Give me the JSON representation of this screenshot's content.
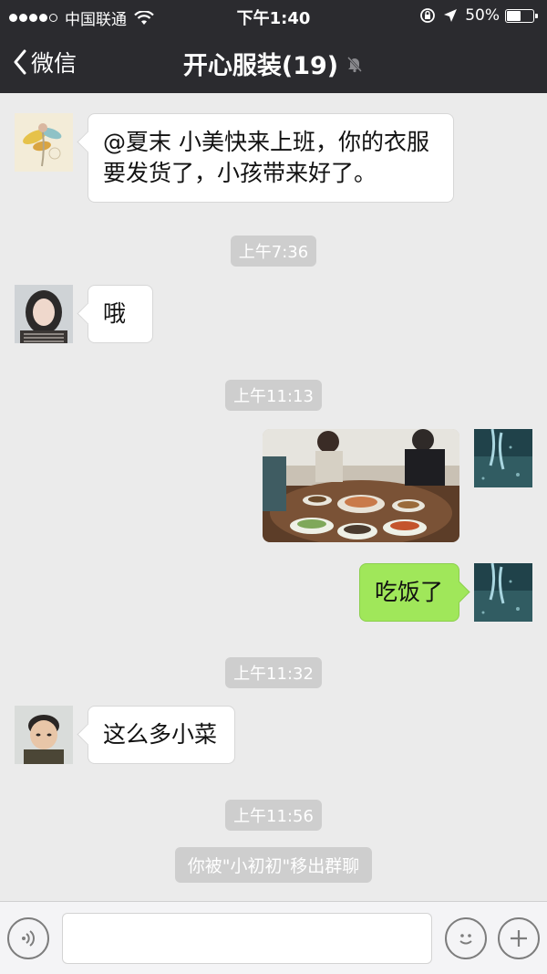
{
  "status_bar": {
    "carrier": "中国联通",
    "time": "下午1:40",
    "battery": "50%",
    "battery_level": 0.5,
    "signal_bars": 4
  },
  "nav": {
    "back_label": "微信",
    "title": "开心服装(19)"
  },
  "messages": [
    {
      "sender_side": "left",
      "avatar": "flower-illustration-avatar",
      "text": "@夏末 小美快来上班，你的衣服要发货了，小孩带来好了。"
    },
    {
      "timestamp": "上午7:36"
    },
    {
      "sender_side": "left",
      "avatar": "woman-avatar",
      "text": "哦"
    },
    {
      "timestamp": "上午11:13"
    },
    {
      "sender_side": "right",
      "avatar": "blue-water-avatar",
      "type": "image",
      "image": "family-dinner-photo"
    },
    {
      "sender_side": "right",
      "avatar": "blue-water-avatar",
      "text": "吃饭了"
    },
    {
      "timestamp": "上午11:32"
    },
    {
      "sender_side": "left",
      "avatar": "child-avatar",
      "text": "这么多小菜"
    },
    {
      "timestamp": "上午11:56"
    },
    {
      "system": "你被\"小初初\"移出群聊"
    }
  ],
  "input_bar": {
    "voice_icon": "voice-icon",
    "emoji_icon": "emoji-icon",
    "plus_icon": "plus-icon"
  },
  "colors": {
    "header": "#2b2b2f",
    "chat_background": "#ebebeb",
    "sent_bubble": "#a0e75a",
    "timestamp_pill": "#cecece"
  }
}
